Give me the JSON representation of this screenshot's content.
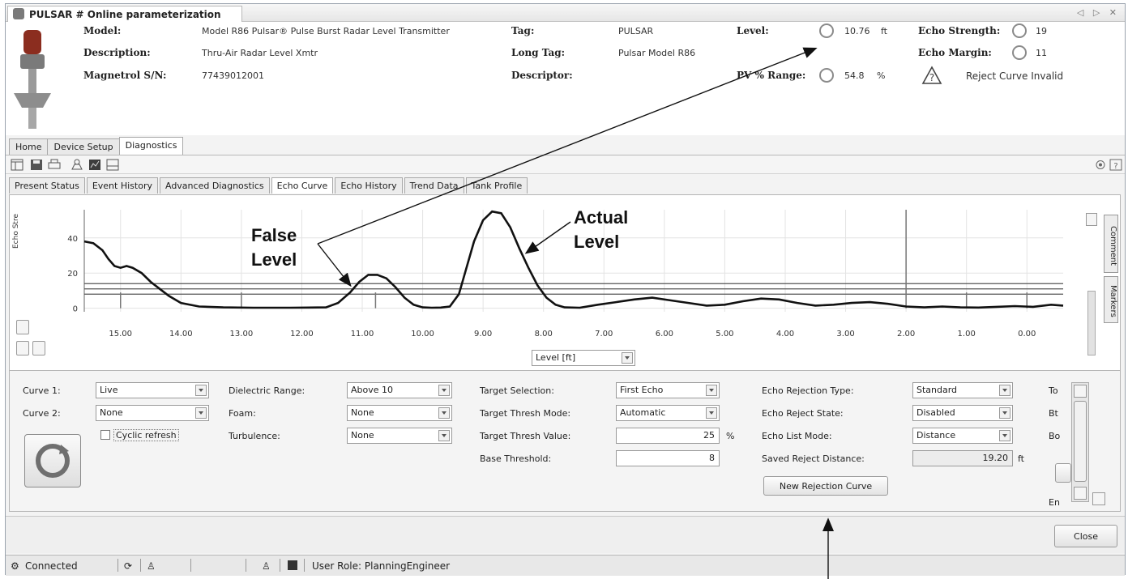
{
  "window": {
    "title": "PULSAR # Online parameterization",
    "controls": "◁ ▷ ✕"
  },
  "header": {
    "model_label": "Model:",
    "model_value": "Model R86 Pulsar® Pulse Burst Radar Level Transmitter",
    "description_label": "Description:",
    "description_value": "Thru-Air Radar Level Xmtr",
    "serial_label": "Magnetrol S/N:",
    "serial_value": "77439012001",
    "tag_label": "Tag:",
    "tag_value": "PULSAR",
    "longtag_label": "Long Tag:",
    "longtag_value": "Pulsar Model R86",
    "descriptor_label": "Descriptor:",
    "descriptor_value": "",
    "level_label": "Level:",
    "level_value": "10.76",
    "level_unit": "ft",
    "pv_label": "PV % Range:",
    "pv_value": "54.8",
    "pv_unit": "%",
    "echo_strength_label": "Echo Strength:",
    "echo_strength_value": "19",
    "echo_margin_label": "Echo Margin:",
    "echo_margin_value": "11",
    "status_text": "Reject Curve Invalid"
  },
  "main_tabs": [
    "Home",
    "Device Setup",
    "Diagnostics"
  ],
  "sub_tabs": [
    "Present Status",
    "Event History",
    "Advanced Diagnostics",
    "Echo Curve",
    "Echo History",
    "Trend Data",
    "Tank Profile"
  ],
  "side_tabs": [
    "Comment",
    "Markers"
  ],
  "plot": {
    "x_axis_select": "Level [ft]"
  },
  "controls": {
    "curve1_label": "Curve 1:",
    "curve1_value": "Live",
    "curve2_label": "Curve 2:",
    "curve2_value": "None",
    "cyclic_label": "Cyclic refresh",
    "dielectric_label": "Dielectric Range:",
    "dielectric_value": "Above 10",
    "foam_label": "Foam:",
    "foam_value": "None",
    "turbulence_label": "Turbulence:",
    "turbulence_value": "None",
    "target_sel_label": "Target Selection:",
    "target_sel_value": "First Echo",
    "thresh_mode_label": "Target Thresh Mode:",
    "thresh_mode_value": "Automatic",
    "thresh_value_label": "Target Thresh Value:",
    "thresh_value": "25",
    "thresh_unit": "%",
    "base_thresh_label": "Base Threshold:",
    "base_thresh_value": "8",
    "rej_type_label": "Echo Rejection Type:",
    "rej_type_value": "Standard",
    "rej_state_label": "Echo Reject State:",
    "rej_state_value": "Disabled",
    "list_mode_label": "Echo List Mode:",
    "list_mode_value": "Distance",
    "saved_rej_label": "Saved Reject Distance:",
    "saved_rej_value": "19.20",
    "saved_rej_unit": "ft",
    "new_rej_button": "New Rejection Curve",
    "cut_labels": [
      "To",
      "Bt",
      "Bo",
      "En"
    ]
  },
  "close_button": "Close",
  "status": {
    "connected": "Connected",
    "user_role": "User Role: PlanningEngineer"
  },
  "annotations": {
    "false_level": [
      "False",
      "Level"
    ],
    "actual_level": [
      "Actual",
      "Level"
    ]
  },
  "chart_data": {
    "type": "line",
    "ylabel": "Echo Stre",
    "xlabel": "Level [ft]",
    "x_ticks": [
      "15.00",
      "14.00",
      "13.00",
      "12.00",
      "11.00",
      "10.00",
      "9.00",
      "8.00",
      "7.00",
      "6.00",
      "5.00",
      "4.00",
      "3.00",
      "2.00",
      "1.00",
      "0.00"
    ],
    "y_ticks": [
      "0",
      "20",
      "40"
    ],
    "xlim": [
      15.6,
      -0.6
    ],
    "ylim": [
      -2,
      56
    ],
    "series": [
      {
        "x": [
          15.6,
          15.45,
          15.3,
          15.2,
          15.1,
          15.0,
          14.9,
          14.8,
          14.65,
          14.5,
          14.35,
          14.2,
          14.0,
          13.7,
          13.3,
          12.8,
          12.2,
          11.6,
          11.4,
          11.2,
          11.05,
          10.9,
          10.75,
          10.6,
          10.45,
          10.3,
          10.15,
          10.0,
          9.85,
          9.7,
          9.55,
          9.4,
          9.3,
          9.15,
          9.0,
          8.85,
          8.7,
          8.55,
          8.4,
          8.25,
          8.1,
          7.95,
          7.8,
          7.65,
          7.4,
          7.1,
          6.8,
          6.5,
          6.2,
          5.9,
          5.6,
          5.3,
          5.0,
          4.7,
          4.4,
          4.1,
          3.8,
          3.5,
          3.2,
          2.9,
          2.6,
          2.3,
          2.0,
          1.7,
          1.4,
          1.1,
          0.8,
          0.5,
          0.2,
          -0.1,
          -0.4,
          -0.6
        ],
        "y": [
          38,
          37,
          33,
          28,
          24,
          23,
          24,
          23,
          20,
          15,
          11,
          7,
          3,
          1,
          0.5,
          0.3,
          0.3,
          0.5,
          3,
          9,
          15,
          19,
          19,
          17,
          12,
          6,
          2,
          0.5,
          0.3,
          0.4,
          1,
          8,
          20,
          38,
          50,
          55,
          54,
          46,
          34,
          23,
          13,
          6,
          2,
          0.5,
          0.3,
          2,
          3.5,
          5,
          6,
          4.5,
          3,
          1.5,
          2,
          4,
          5.5,
          5,
          3,
          1.5,
          2,
          3,
          3.5,
          2.5,
          1,
          0.5,
          1,
          0.5,
          0.4,
          0.8,
          1.2,
          0.8,
          2,
          1.5
        ]
      }
    ],
    "threshold_lines": [
      14,
      11,
      8
    ],
    "marker_x": [
      15.0,
      13.0,
      10.78,
      2.0,
      1.0,
      0.0
    ]
  }
}
